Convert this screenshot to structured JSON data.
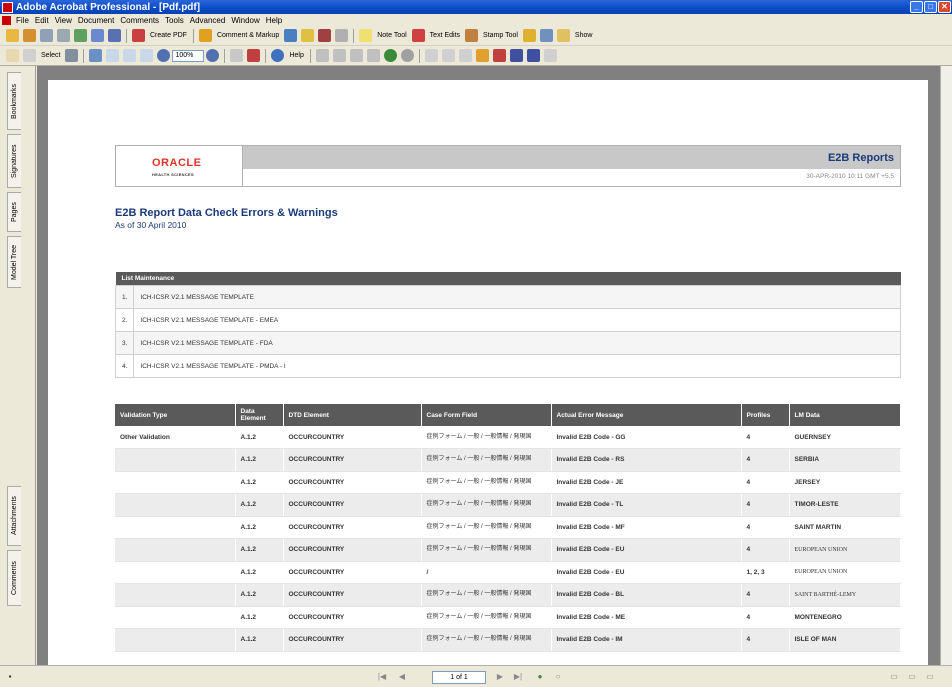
{
  "window": {
    "title": "Adobe Acrobat Professional - [Pdf.pdf]"
  },
  "menu": [
    "File",
    "Edit",
    "View",
    "Document",
    "Comments",
    "Tools",
    "Advanced",
    "Window",
    "Help"
  ],
  "toolbar1": {
    "create_pdf": "Create PDF",
    "comment_markup": "Comment & Markup",
    "note_tool": "Note Tool",
    "text_edits": "Text Edits",
    "stamp_tool": "Stamp Tool",
    "show": "Show"
  },
  "toolbar2": {
    "select": "Select",
    "zoom": "100%",
    "help": "Help"
  },
  "nav_tabs": [
    "Bookmarks",
    "Signatures",
    "Pages",
    "Model Tree",
    "Attachments",
    "Comments"
  ],
  "report": {
    "brand": "ORACLE",
    "brand_sub": "HEALTH SCIENCES",
    "title": "E2B Reports",
    "date": "30-APR-2010 10:11 GMT +5.5",
    "main_title": "E2B Report Data Check Errors & Warnings",
    "subtitle": "As of 30 April 2010"
  },
  "list_maintenance": {
    "header": "List Maintenance",
    "items": [
      {
        "num": "1.",
        "text": "ICH-ICSR V2.1 MESSAGE TEMPLATE"
      },
      {
        "num": "2.",
        "text": "ICH-ICSR V2.1 MESSAGE TEMPLATE - EMEA"
      },
      {
        "num": "3.",
        "text": "ICH-ICSR V2.1 MESSAGE TEMPLATE - FDA"
      },
      {
        "num": "4.",
        "text": "ICH-ICSR V2.1 MESSAGE TEMPLATE - PMDA - I"
      }
    ]
  },
  "validation_table": {
    "headers": [
      "Validation Type",
      "Data Element",
      "DTD Element",
      "Case Form Field",
      "Actual Error Message",
      "Profiles",
      "LM Data"
    ],
    "rows": [
      {
        "type": "Other Validation",
        "element": "A.1.2",
        "dtd": "OCCURCOUNTRY",
        "field": "症例フォーム / 一般 / 一般情報 / 発現国",
        "error": "Invalid E2B Code - GG",
        "profiles": "4",
        "lm": "GUERNSEY"
      },
      {
        "type": "",
        "element": "A.1.2",
        "dtd": "OCCURCOUNTRY",
        "field": "症例フォーム / 一般 / 一般情報 / 発現国",
        "error": "Invalid E2B Code - RS",
        "profiles": "4",
        "lm": "SERBIA"
      },
      {
        "type": "",
        "element": "A.1.2",
        "dtd": "OCCURCOUNTRY",
        "field": "症例フォーム / 一般 / 一般情報 / 発現国",
        "error": "Invalid E2B Code - JE",
        "profiles": "4",
        "lm": "JERSEY"
      },
      {
        "type": "",
        "element": "A.1.2",
        "dtd": "OCCURCOUNTRY",
        "field": "症例フォーム / 一般 / 一般情報 / 発現国",
        "error": "Invalid E2B Code - TL",
        "profiles": "4",
        "lm": "TIMOR-LESTE"
      },
      {
        "type": "",
        "element": "A.1.2",
        "dtd": "OCCURCOUNTRY",
        "field": "症例フォーム / 一般 / 一般情報 / 発現国",
        "error": "Invalid E2B Code - MF",
        "profiles": "4",
        "lm": "SAINT MARTIN"
      },
      {
        "type": "",
        "element": "A.1.2",
        "dtd": "OCCURCOUNTRY",
        "field": "症例フォーム / 一般 / 一般情報 / 発現国",
        "error": "Invalid E2B Code - EU",
        "profiles": "4",
        "lm": "EUROPEAN UNION"
      },
      {
        "type": "",
        "element": "A.1.2",
        "dtd": "OCCURCOUNTRY",
        "field": "/",
        "error": "Invalid E2B Code - EU",
        "profiles": "1, 2, 3",
        "lm": "EUROPEAN UNION"
      },
      {
        "type": "",
        "element": "A.1.2",
        "dtd": "OCCURCOUNTRY",
        "field": "症例フォーム / 一般 / 一般情報 / 発現国",
        "error": "Invalid E2B Code - BL",
        "profiles": "4",
        "lm": "SAINT BARTHÉ-LEMY"
      },
      {
        "type": "",
        "element": "A.1.2",
        "dtd": "OCCURCOUNTRY",
        "field": "症例フォーム / 一般 / 一般情報 / 発現国",
        "error": "Invalid E2B Code - ME",
        "profiles": "4",
        "lm": "MONTENEGRO"
      },
      {
        "type": "",
        "element": "A.1.2",
        "dtd": "OCCURCOUNTRY",
        "field": "症例フォーム / 一般 / 一般情報 / 発現国",
        "error": "Invalid E2B Code - IM",
        "profiles": "4",
        "lm": "ISLE OF MAN"
      }
    ]
  },
  "statusbar": {
    "page": "1 of 1"
  },
  "colors": {
    "titlebar": "#0a4ac6",
    "oracle_red": "#e0322a",
    "report_blue": "#1a3a7a",
    "table_header": "#5a5a5a"
  }
}
